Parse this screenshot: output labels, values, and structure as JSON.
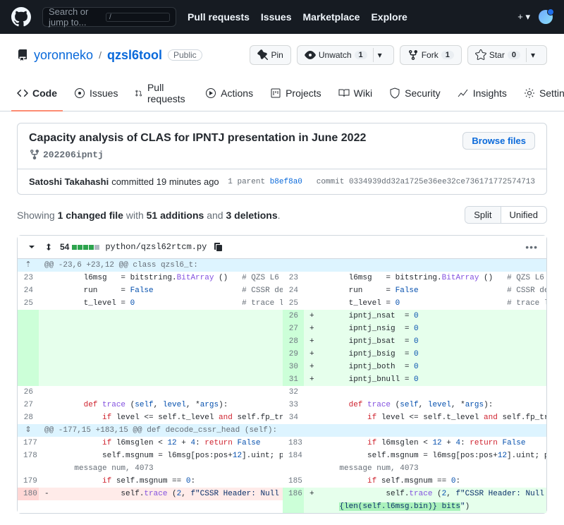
{
  "search": {
    "placeholder": "Search or jump to...",
    "kbd": "/"
  },
  "nav": {
    "pulls": "Pull requests",
    "issues": "Issues",
    "marketplace": "Marketplace",
    "explore": "Explore"
  },
  "repo": {
    "owner": "yoronneko",
    "name": "qzsl6tool",
    "visibility": "Public",
    "pin": "Pin",
    "unwatch": "Unwatch",
    "unwatch_count": "1",
    "fork": "Fork",
    "fork_count": "1",
    "star": "Star",
    "star_count": "0"
  },
  "tabs": {
    "code": "Code",
    "issues": "Issues",
    "pulls": "Pull requests",
    "actions": "Actions",
    "projects": "Projects",
    "wiki": "Wiki",
    "security": "Security",
    "insights": "Insights",
    "settings": "Settings"
  },
  "commit": {
    "title": "Capacity analysis of CLAS for IPNTJ presentation in June 2022",
    "branch": "202206ipntj",
    "browse": "Browse files",
    "author": "Satoshi Takahashi",
    "action": " committed 19 minutes ago",
    "parent_label": "1 parent ",
    "parent_sha": "b8ef8a0",
    "commit_label": "commit ",
    "sha": "0334939dd32a1725e36ee32ce736171772574713"
  },
  "summary": {
    "prefix": "Showing ",
    "files": "1 changed file",
    "with": " with ",
    "adds": "51 additions",
    "and": " and ",
    "dels": "3 deletions"
  },
  "view": {
    "split": "Split",
    "unified": "Unified"
  },
  "file": {
    "count": "54",
    "path": "python/qzsl62rtcm.py"
  },
  "hunk1": "@@ -23,6 +23,12 @@ class qzsl6_t:",
  "hunk2": "@@ -177,15 +183,15 @@ def decode_cssr_head (self):"
}
